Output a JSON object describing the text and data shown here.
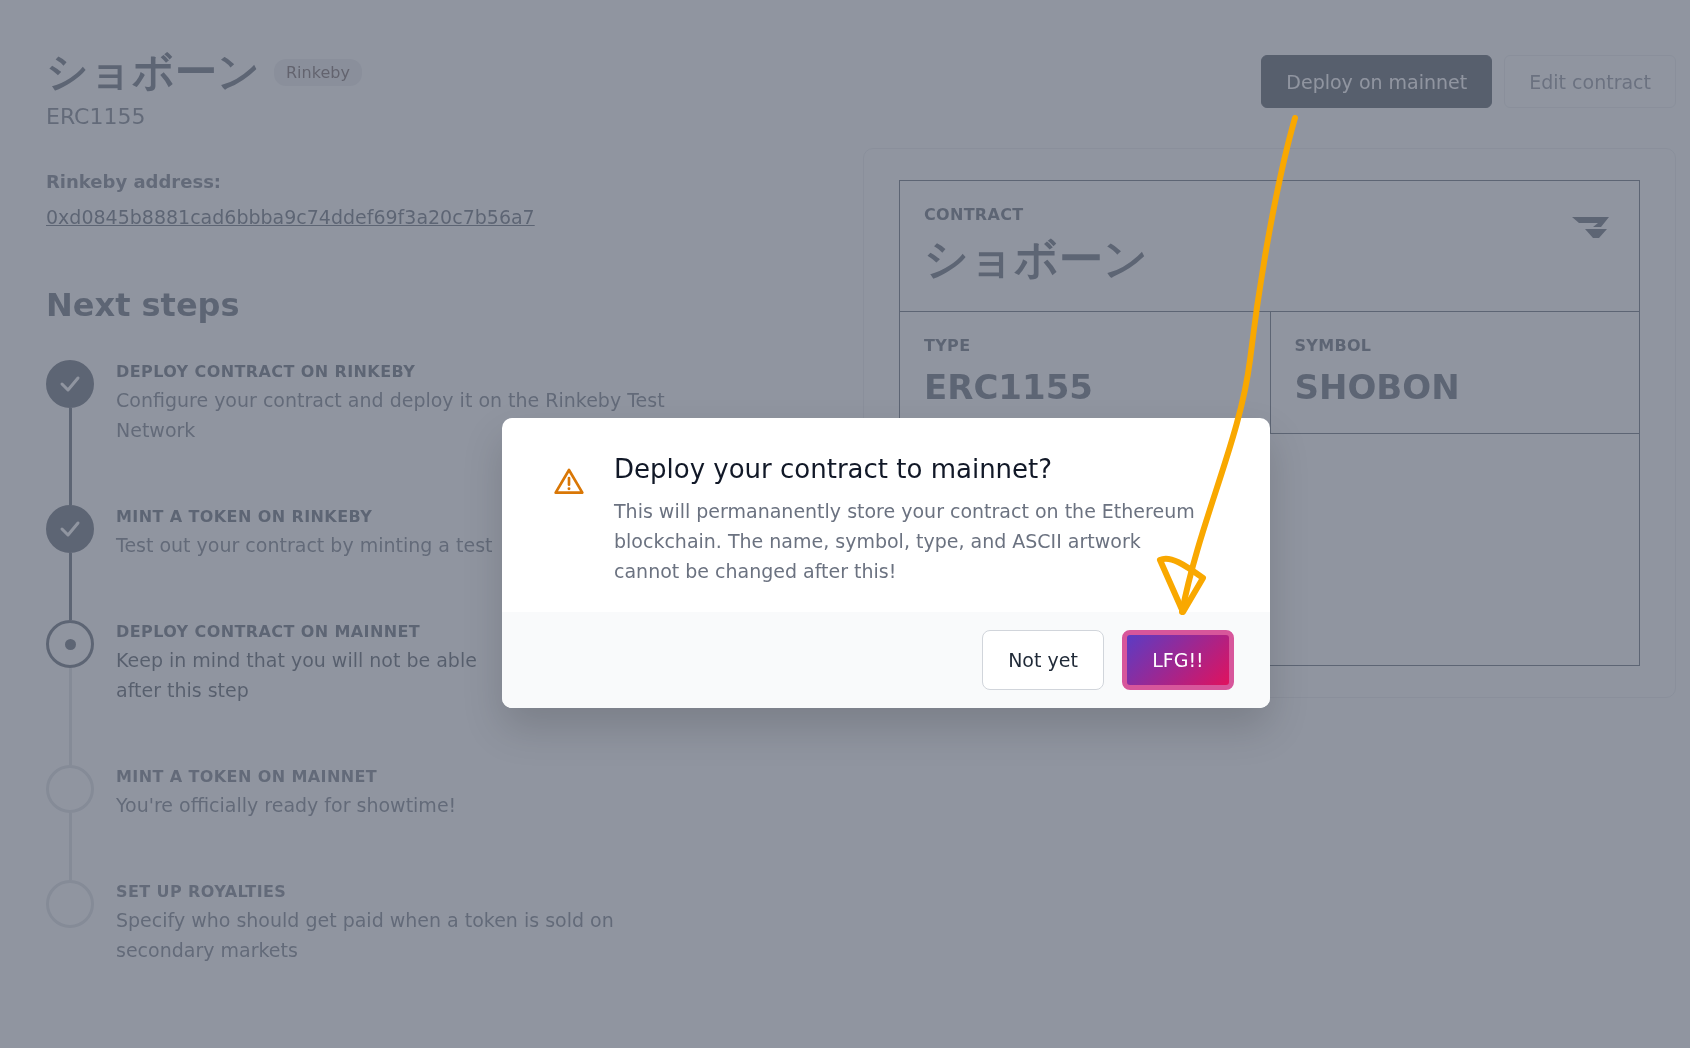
{
  "header": {
    "title": "ショボーン",
    "network_badge": "Rinkeby",
    "subtitle": "ERC1155"
  },
  "address": {
    "label": "Rinkeby address:",
    "value": "0xd0845b8881cad6bbba9c74ddef69f3a20c7b56a7"
  },
  "actions": [
    {
      "label": "Deploy on mainnet",
      "kind": "primary"
    },
    {
      "label": "Edit contract",
      "kind": "secondary"
    }
  ],
  "next_steps": {
    "title": "Next steps",
    "steps": [
      {
        "title": "DEPLOY CONTRACT ON RINKEBY",
        "lines": [
          "Configure your contract and deploy it on the Rinkeby Test",
          "Network"
        ],
        "completed": true,
        "active": false
      },
      {
        "title": "MINT A TOKEN ON RINKEBY",
        "lines": [
          "Test out your contract by minting a test"
        ],
        "completed": true,
        "active": false
      },
      {
        "title": "DEPLOY CONTRACT ON MAINNET",
        "lines": [
          "Keep in mind that you will not be able",
          "after this step"
        ],
        "completed": false,
        "active": true
      },
      {
        "title": "MINT A TOKEN ON MAINNET",
        "lines": [
          "You're officially ready for showtime!"
        ],
        "completed": false,
        "active": false
      },
      {
        "title": "SET UP ROYALTIES",
        "lines": [
          "Specify who should get paid when a token is sold on",
          "secondary markets"
        ],
        "completed": false,
        "active": false
      }
    ]
  },
  "contract_card": {
    "contract_label": "CONTRACT",
    "name": "ショボーン",
    "type_label": "TYPE",
    "type": "ERC1155",
    "symbol_label": "SYMBOL",
    "symbol": "SHOBON"
  },
  "dialog": {
    "title": "Deploy your contract to mainnet?",
    "message": "This will permananently store your contract on the Ethereum blockchain. The name, symbol, type, and ASCII artwork cannot be changed after this!",
    "buttons": [
      {
        "label": "Not yet",
        "kind": "secondary"
      },
      {
        "label": "LFG!!",
        "kind": "primary"
      }
    ]
  }
}
